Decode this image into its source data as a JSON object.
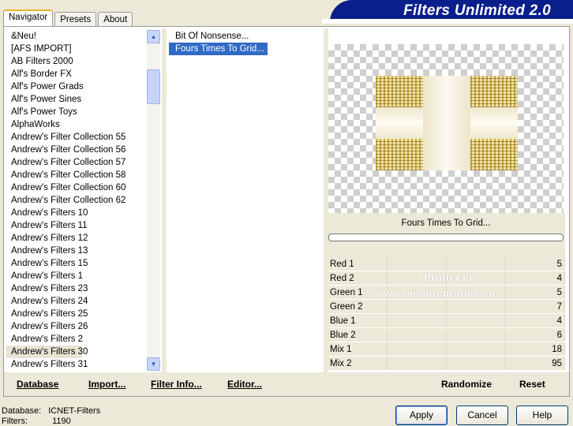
{
  "tabs": [
    "Navigator",
    "Presets",
    "About"
  ],
  "banner_title": "Filters Unlimited 2.0",
  "categories": [
    "&Neu!",
    "[AFS IMPORT]",
    "AB Filters 2000",
    "Alf's Border FX",
    "Alf's Power Grads",
    "Alf's Power Sines",
    "Alf's Power Toys",
    "AlphaWorks",
    "Andrew's Filter Collection 55",
    "Andrew's Filter Collection 56",
    "Andrew's Filter Collection 57",
    "Andrew's Filter Collection 58",
    "Andrew's Filter Collection 60",
    "Andrew's Filter Collection 62",
    "Andrew's Filters 10",
    "Andrew's Filters 11",
    "Andrew's Filters 12",
    "Andrew's Filters 13",
    "Andrew's Filters 15",
    "Andrew's Filters 1",
    "Andrew's Filters 23",
    "Andrew's Filters 24",
    "Andrew's Filters 25",
    "Andrew's Filters 26",
    "Andrew's Filters 2",
    "Andrew's Filters 30",
    "Andrew's Filters 31"
  ],
  "selected_category": "Andrew's Filters 30",
  "filters": [
    "Bit Of Nonsense...",
    "Fours Times To Grid..."
  ],
  "selected_filter": "Fours Times To Grid...",
  "preview_filter_name": "Fours Times To Grid...",
  "params": [
    {
      "label": "Red 1",
      "value": "5"
    },
    {
      "label": "Red 2",
      "value": "4"
    },
    {
      "label": "Green 1",
      "value": "5"
    },
    {
      "label": "Green 2",
      "value": "7"
    },
    {
      "label": "Blue 1",
      "value": "4"
    },
    {
      "label": "Blue 2",
      "value": "6"
    },
    {
      "label": "Mix 1",
      "value": "18"
    },
    {
      "label": "Mix 2",
      "value": "95"
    }
  ],
  "watermark": {
    "line1": "Pinuccia",
    "line2": "www.misdiregrafies.eu"
  },
  "toolbar": {
    "database": "Database",
    "import": "Import...",
    "filter_info": "Filter Info...",
    "editor": "Editor...",
    "randomize": "Randomize",
    "reset": "Reset"
  },
  "status": {
    "database_label": "Database:",
    "database_value": "ICNET-Filters",
    "filters_label": "Filters:",
    "filters_value": "1190"
  },
  "buttons": {
    "apply": "Apply",
    "cancel": "Cancel",
    "help": "Help"
  }
}
